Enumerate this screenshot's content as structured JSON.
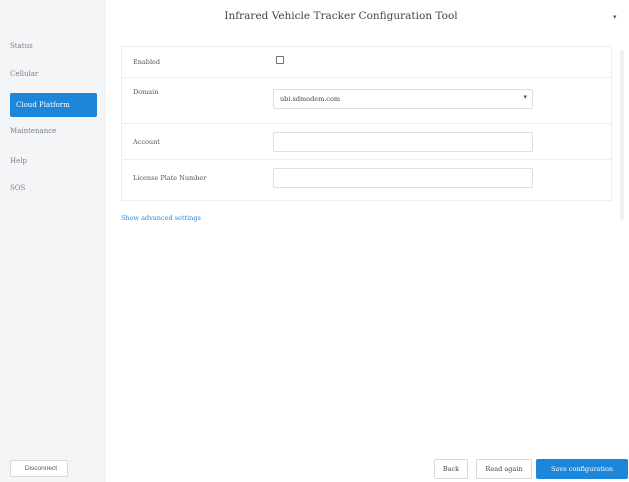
{
  "header": {
    "title": "Infrared Vehicle Tracker Configuration Tool",
    "dropdown_icon": "chevron-down-icon"
  },
  "sidebar": {
    "items": [
      {
        "label": "Status",
        "active": false
      },
      {
        "label": "Cellular",
        "active": false
      },
      {
        "label": "Cloud Platform",
        "active": true
      },
      {
        "label": "Maintenance",
        "active": false
      },
      {
        "label": "Help",
        "active": false
      },
      {
        "label": "SOS",
        "active": false
      }
    ],
    "disconnect_label": "Disconnect"
  },
  "form": {
    "enabled": {
      "label": "Enabled",
      "checked": false
    },
    "domain": {
      "label": "Domain",
      "value": "ubi.sdmodem.com"
    },
    "account": {
      "label": "Account",
      "value": ""
    },
    "license_plate": {
      "label": "License Plate Number",
      "value": ""
    },
    "advanced_link": "Show advanced settings"
  },
  "footer": {
    "back_label": "Back",
    "apply_label": "Read again",
    "save_label": "Save configuration"
  },
  "colors": {
    "accent": "#1e86d9",
    "sidebar_bg": "#f4f5f7",
    "border": "#eceef1"
  }
}
